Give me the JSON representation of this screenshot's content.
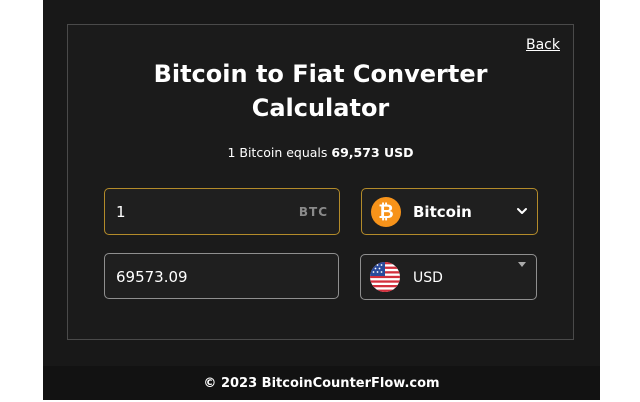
{
  "header": {
    "back_label": "Back",
    "title_line1": "Bitcoin to Fiat Converter",
    "title_line2": "Calculator"
  },
  "rate": {
    "prefix": "1 Bitcoin equals",
    "value": "69,573 USD"
  },
  "crypto": {
    "amount": "1",
    "unit": "BTC",
    "selected": "Bitcoin",
    "icon": "bitcoin-icon",
    "icon_symbol": "₿",
    "accent_color": "#f7931a"
  },
  "fiat": {
    "amount": "69573.09",
    "selected": "USD",
    "icon": "us-flag-icon"
  },
  "footer": {
    "copyright": "© 2023 BitcoinCounterFlow.com"
  },
  "colors": {
    "background": "#181818",
    "active_border": "#b38b2a",
    "inactive_border": "#8f8f8f"
  }
}
